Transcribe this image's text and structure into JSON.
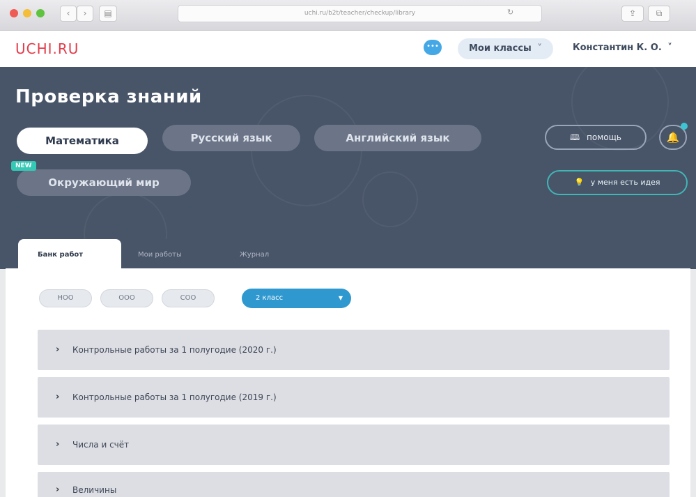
{
  "browser": {
    "address": "uchi.ru/b2t/teacher/checkup/library",
    "back": "‹",
    "forward": "›",
    "sidebar": "▤",
    "share": "⇪",
    "tabs": "⧉",
    "reload": "↻"
  },
  "header": {
    "logo": "UCHI.RU",
    "chat_icon": "•••",
    "classes_label": "Мои классы",
    "classes_arrow": "˅",
    "user_name": "Константин К. О.",
    "user_arrow": "˅"
  },
  "hero": {
    "title": "Проверка знаний",
    "subjects": [
      {
        "label": "Математика",
        "active": true
      },
      {
        "label": "Русский язык",
        "active": false
      },
      {
        "label": "Английский язык",
        "active": false
      },
      {
        "label": "Окружающий мир",
        "active": false
      }
    ],
    "new_badge": "NEW",
    "help_label": "помощь",
    "help_icon": "🕮",
    "bell_icon": "🔔",
    "idea_label": "у меня есть идея",
    "idea_icon": "💡"
  },
  "tabs": [
    {
      "label": "Банк работ",
      "active": true
    },
    {
      "label": "Мои работы",
      "active": false
    },
    {
      "label": "Журнал",
      "active": false
    }
  ],
  "filters": {
    "levels": [
      "НОО",
      "ООО",
      "СОО"
    ],
    "grade": "2 класс",
    "grade_arrow": "▼"
  },
  "accordion": [
    {
      "label": "Контрольные работы за 1 полугодие (2020 г.)",
      "chevron": "›"
    },
    {
      "label": "Контрольные работы за 1 полугодие (2019 г.)",
      "chevron": "›"
    },
    {
      "label": "Числа и счёт",
      "chevron": "›"
    },
    {
      "label": "Величины",
      "chevron": "›"
    }
  ],
  "colors": {
    "hero_bg": "#485468",
    "logo_red": "#e23c4a",
    "accent_blue": "#2f98cf",
    "accent_teal": "#3fb7b5"
  }
}
